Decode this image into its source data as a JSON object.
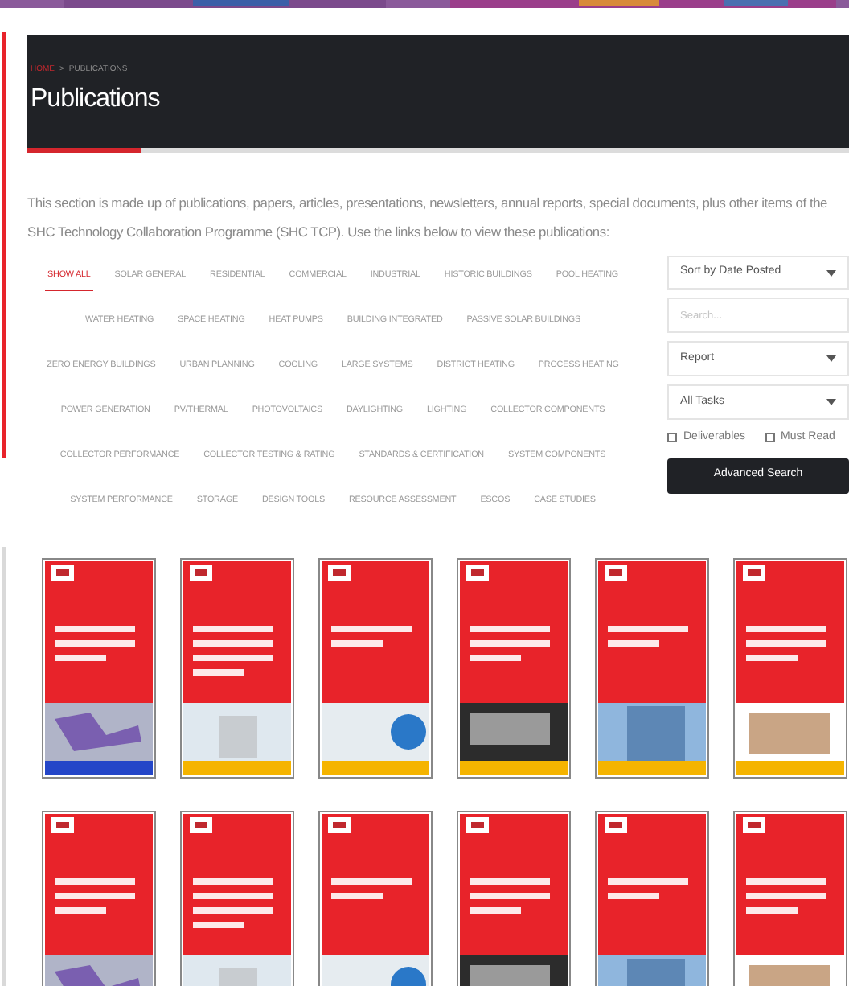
{
  "header": {
    "breadcrumb": [
      {
        "label": "HOME",
        "selected": false
      },
      {
        "label": "PUBLICATIONS",
        "selected": true
      }
    ],
    "separator": ">",
    "title": "Publications"
  },
  "intro": "This section is made up of publications, papers, articles, presentations, newsletters, annual reports, special documents, plus other items of the SHC Technology Collaboration Programme (SHC TCP).  Use the links below to view these publications:",
  "filter_rows": [
    {
      "tags": [
        {
          "label": "SHOW ALL",
          "selected": true
        },
        {
          "label": "SOLAR GENERAL",
          "selected": false
        },
        {
          "label": "RESIDENTIAL",
          "selected": false
        },
        {
          "label": "COMMERCIAL",
          "selected": false
        },
        {
          "label": "INDUSTRIAL",
          "selected": false
        },
        {
          "label": "HISTORIC BUILDINGS",
          "selected": false
        },
        {
          "label": "POOL HEATING",
          "selected": false
        }
      ]
    },
    {
      "tags": [
        {
          "label": "WATER HEATING",
          "selected": false
        },
        {
          "label": "SPACE HEATING",
          "selected": false
        },
        {
          "label": "HEAT PUMPS",
          "selected": false
        },
        {
          "label": "BUILDING INTEGRATED",
          "selected": false
        },
        {
          "label": "PASSIVE SOLAR BUILDINGS",
          "selected": false
        }
      ]
    },
    {
      "tags": [
        {
          "label": "ZERO ENERGY BUILDINGS",
          "selected": false
        },
        {
          "label": "URBAN PLANNING",
          "selected": false
        },
        {
          "label": "COOLING",
          "selected": false
        },
        {
          "label": "LARGE SYSTEMS",
          "selected": false
        },
        {
          "label": "DISTRICT HEATING",
          "selected": false
        },
        {
          "label": "PROCESS HEATING",
          "selected": false
        }
      ]
    },
    {
      "tags": [
        {
          "label": "POWER GENERATION",
          "selected": false
        },
        {
          "label": "PV/THERMAL",
          "selected": false
        },
        {
          "label": "PHOTOVOLTAICS",
          "selected": false
        },
        {
          "label": "DAYLIGHTING",
          "selected": false
        },
        {
          "label": "LIGHTING",
          "selected": false
        },
        {
          "label": "COLLECTOR COMPONENTS",
          "selected": false
        }
      ]
    },
    {
      "tags": [
        {
          "label": "COLLECTOR PERFORMANCE",
          "selected": false
        },
        {
          "label": "COLLECTOR TESTING & RATING",
          "selected": false
        },
        {
          "label": "STANDARDS & CERTIFICATION",
          "selected": false
        },
        {
          "label": "SYSTEM COMPONENTS",
          "selected": false
        }
      ]
    },
    {
      "tags": [
        {
          "label": "SYSTEM PERFORMANCE",
          "selected": false
        },
        {
          "label": "STORAGE",
          "selected": false
        },
        {
          "label": "DESIGN TOOLS",
          "selected": false
        },
        {
          "label": "RESOURCE ASSESSMENT",
          "selected": false
        },
        {
          "label": "ESCOS",
          "selected": false
        },
        {
          "label": "CASE STUDIES",
          "selected": false
        }
      ]
    }
  ],
  "search_panel": {
    "sort": "Sort by Date Posted",
    "search": {
      "placeholder": "Search..."
    },
    "type": "Report",
    "task": "All Tasks",
    "checkboxes": [
      {
        "label": "Deliverables",
        "checked": false
      },
      {
        "label": "Must Read",
        "checked": false
      }
    ],
    "button": "Advanced Search"
  }
}
